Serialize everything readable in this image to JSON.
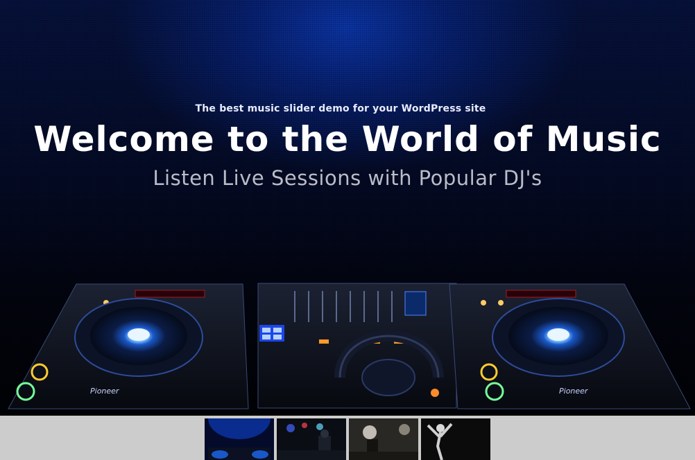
{
  "slider": {
    "kicker": "The best music slider demo for your WordPress site",
    "headline": "Welcome to the World of Music",
    "subheadline": "Listen Live Sessions with Popular DJ's",
    "brand_left": "Pioneer",
    "brand_right": "Pioneer"
  },
  "thumbnails": [
    {
      "name": "dj-decks"
    },
    {
      "name": "dj-live-stage"
    },
    {
      "name": "dj-crowd"
    },
    {
      "name": "dancer"
    }
  ],
  "colors": {
    "background_top": "#0b35a8",
    "background_bottom": "#010205",
    "accent_blue": "#3f8cff",
    "thumb_bar": "#cccccc"
  }
}
